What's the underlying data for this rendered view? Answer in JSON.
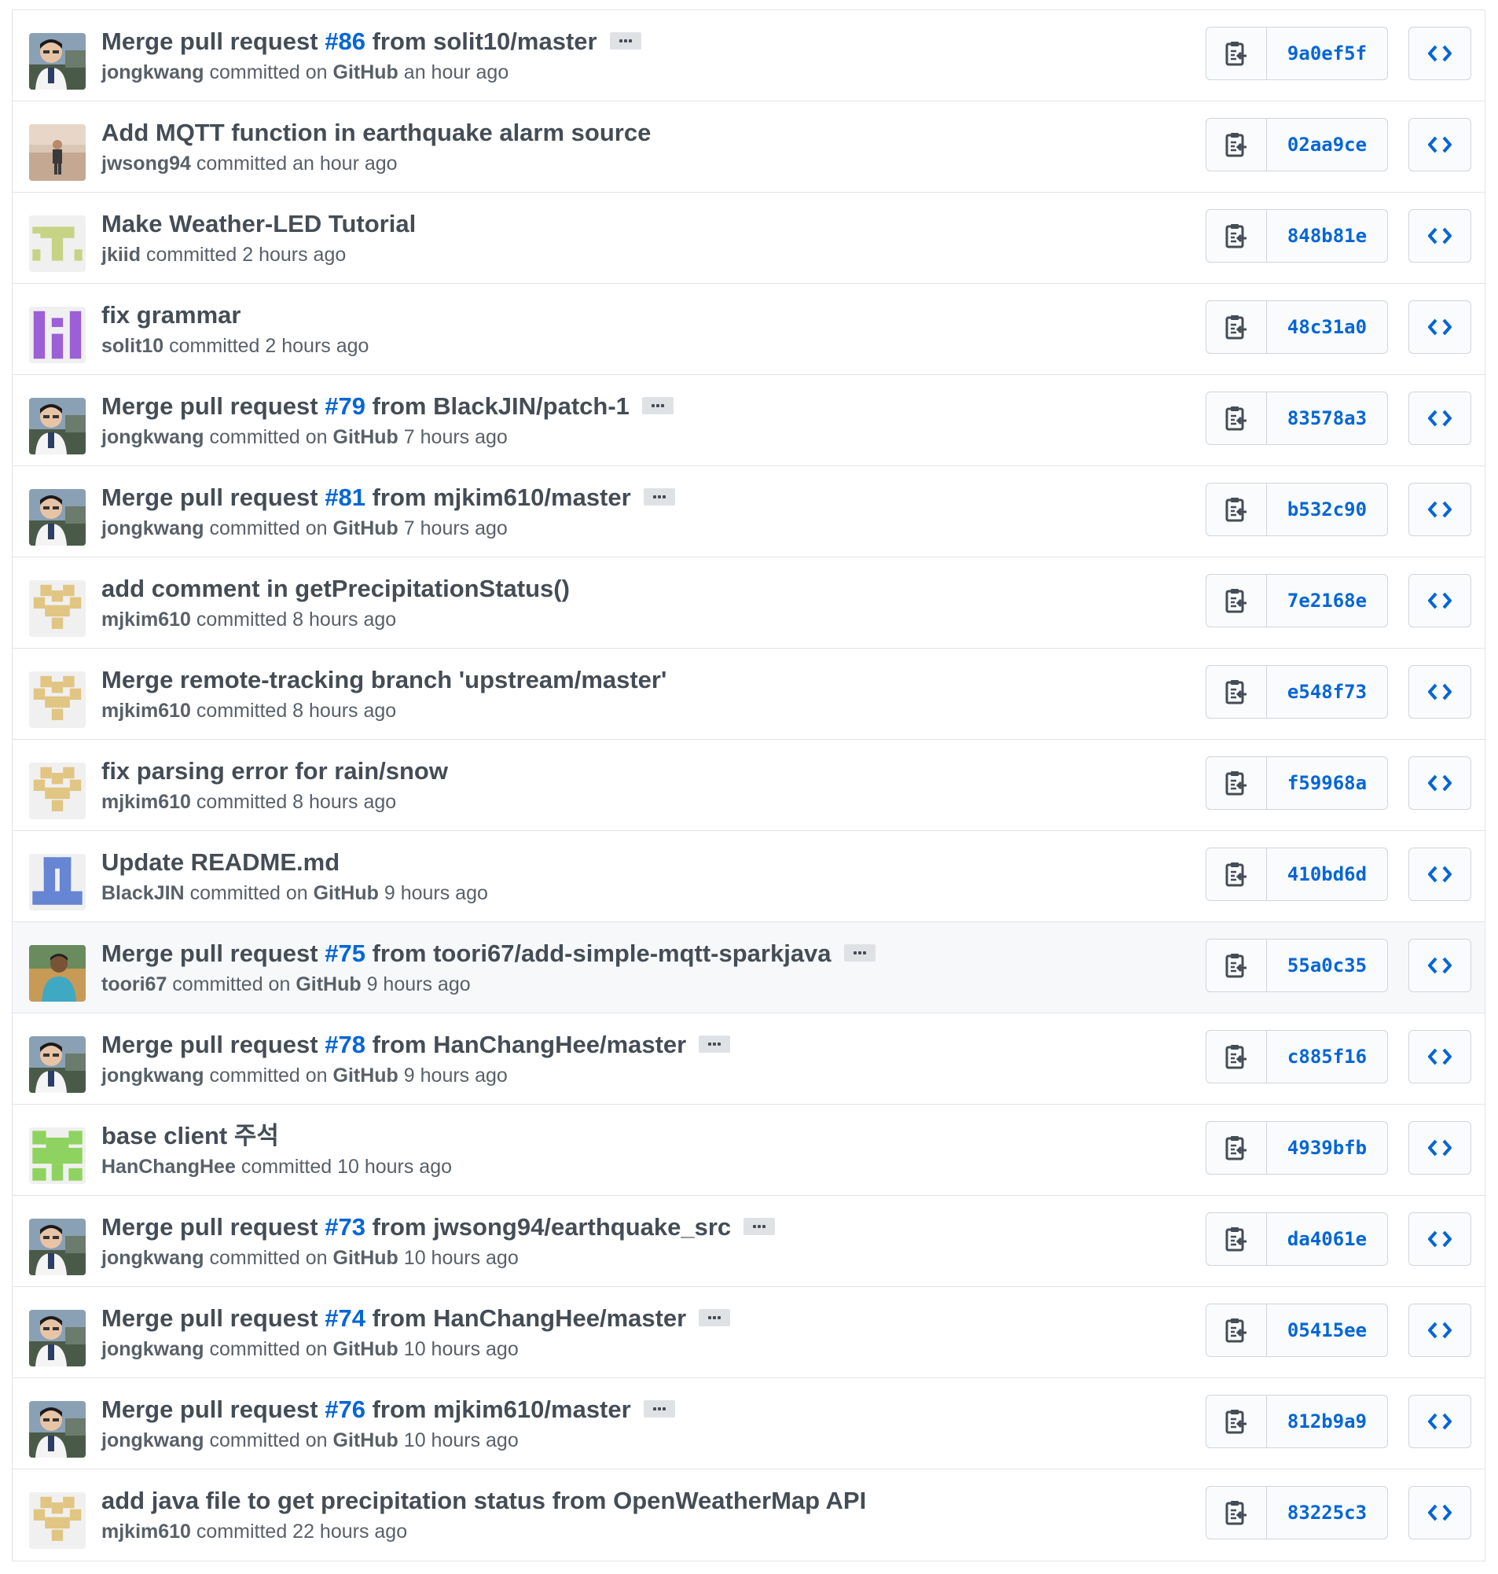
{
  "commits": [
    {
      "type": "pr",
      "title_prefix": "Merge pull request ",
      "pr": "#86",
      "title_suffix": " from solit10/master",
      "author": "jongkwang",
      "via": " committed on ",
      "via_name": "GitHub",
      "time": " an hour ago",
      "sha": "9a0ef5f",
      "avatar": "photo-man"
    },
    {
      "type": "plain",
      "title": "Add MQTT function in earthquake alarm source",
      "author": "jwsong94",
      "time": " committed an hour ago",
      "sha": "02aa9ce",
      "avatar": "photo-field"
    },
    {
      "type": "plain",
      "title": "Make Weather-LED Tutorial",
      "author": "jkiid",
      "time": " committed 2 hours ago",
      "sha": "848b81e",
      "avatar": "identicon-green-t"
    },
    {
      "type": "plain",
      "title": "fix grammar",
      "author": "solit10",
      "time": " committed 2 hours ago",
      "sha": "48c31a0",
      "avatar": "identicon-purple"
    },
    {
      "type": "pr",
      "title_prefix": "Merge pull request ",
      "pr": "#79",
      "title_suffix": " from BlackJIN/patch-1",
      "author": "jongkwang",
      "via": " committed on ",
      "via_name": "GitHub",
      "time": " 7 hours ago",
      "sha": "83578a3",
      "avatar": "photo-man"
    },
    {
      "type": "pr",
      "title_prefix": "Merge pull request ",
      "pr": "#81",
      "title_suffix": " from mjkim610/master",
      "author": "jongkwang",
      "via": " committed on ",
      "via_name": "GitHub",
      "time": " 7 hours ago",
      "sha": "b532c90",
      "avatar": "photo-man"
    },
    {
      "type": "plain",
      "title": "add comment in getPrecipitationStatus()",
      "author": "mjkim610",
      "time": " committed 8 hours ago",
      "sha": "7e2168e",
      "avatar": "identicon-tan"
    },
    {
      "type": "plain",
      "title": "Merge remote-tracking branch 'upstream/master'",
      "author": "mjkim610",
      "time": " committed 8 hours ago",
      "sha": "e548f73",
      "avatar": "identicon-tan"
    },
    {
      "type": "plain",
      "title": "fix parsing error for rain/snow",
      "author": "mjkim610",
      "time": " committed 8 hours ago",
      "sha": "f59968a",
      "avatar": "identicon-tan"
    },
    {
      "type": "pr-nolink",
      "title": "Update README.md",
      "author": "BlackJIN",
      "via": " committed on ",
      "via_name": "GitHub",
      "time": " 9 hours ago",
      "sha": "410bd6d",
      "avatar": "identicon-blue"
    },
    {
      "type": "pr",
      "title_prefix": "Merge pull request ",
      "pr": "#75",
      "title_suffix": " from toori67/add-simple-mqtt-sparkjava",
      "author": "toori67",
      "via": " committed on ",
      "via_name": "GitHub",
      "time": " 9 hours ago",
      "sha": "55a0c35",
      "avatar": "photo-boy",
      "highlight": true
    },
    {
      "type": "pr",
      "title_prefix": "Merge pull request ",
      "pr": "#78",
      "title_suffix": " from HanChangHee/master",
      "author": "jongkwang",
      "via": " committed on ",
      "via_name": "GitHub",
      "time": " 9 hours ago",
      "sha": "c885f16",
      "avatar": "photo-man"
    },
    {
      "type": "plain",
      "title": "base client 주석",
      "author": "HanChangHee",
      "time": " committed 10 hours ago",
      "sha": "4939bfb",
      "avatar": "identicon-lime"
    },
    {
      "type": "pr",
      "title_prefix": "Merge pull request ",
      "pr": "#73",
      "title_suffix": " from jwsong94/earthquake_src",
      "author": "jongkwang",
      "via": " committed on ",
      "via_name": "GitHub",
      "time": " 10 hours ago",
      "sha": "da4061e",
      "avatar": "photo-man"
    },
    {
      "type": "pr",
      "title_prefix": "Merge pull request ",
      "pr": "#74",
      "title_suffix": " from HanChangHee/master",
      "author": "jongkwang",
      "via": " committed on ",
      "via_name": "GitHub",
      "time": " 10 hours ago",
      "sha": "05415ee",
      "avatar": "photo-man"
    },
    {
      "type": "pr",
      "title_prefix": "Merge pull request ",
      "pr": "#76",
      "title_suffix": " from mjkim610/master",
      "author": "jongkwang",
      "via": " committed on ",
      "via_name": "GitHub",
      "time": " 10 hours ago",
      "sha": "812b9a9",
      "avatar": "photo-man"
    },
    {
      "type": "plain",
      "title": "add java file to get precipitation status from OpenWeatherMap API",
      "author": "mjkim610",
      "time": " committed 22 hours ago",
      "sha": "83225c3",
      "avatar": "identicon-tan"
    }
  ],
  "colors": {
    "link": "#0366d6",
    "text": "#444d56",
    "muted": "#586069",
    "border": "#e1e4e8"
  },
  "icons": {
    "copy": "clipboard-icon",
    "browse": "code-brackets-icon",
    "ellipsis": "ellipsis-icon"
  }
}
